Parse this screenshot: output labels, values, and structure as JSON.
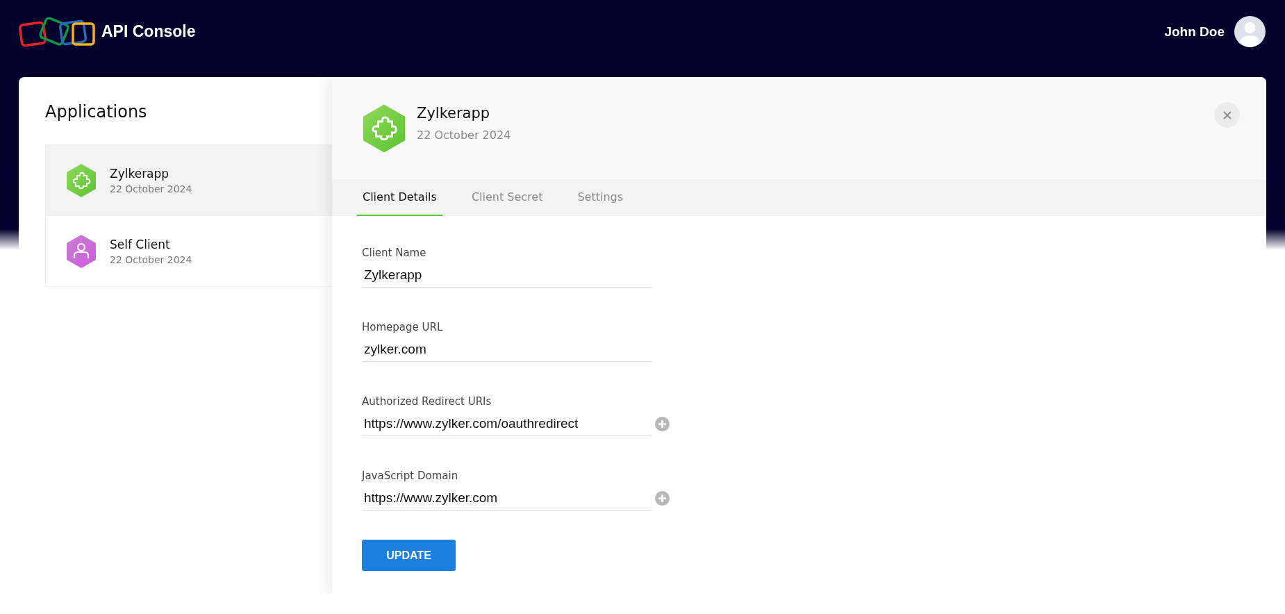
{
  "header": {
    "title": "API Console",
    "user_name": "John Doe"
  },
  "sidebar": {
    "title": "Applications",
    "items": [
      {
        "kind": "server",
        "name": "Zylkerapp",
        "date": "22 October 2024",
        "selected": true
      },
      {
        "kind": "self",
        "name": "Self Client",
        "date": "22 October 2024",
        "selected": false
      }
    ]
  },
  "detail": {
    "kind": "server",
    "name": "Zylkerapp",
    "date": "22 October 2024",
    "tabs": [
      {
        "label": "Client Details",
        "selected": true
      },
      {
        "label": "Client Secret",
        "selected": false
      },
      {
        "label": "Settings",
        "selected": false
      }
    ],
    "fields": [
      {
        "label": "Client Name",
        "value": "Zylkerapp",
        "addable": false
      },
      {
        "label": "Homepage URL",
        "value": "zylker.com",
        "addable": false
      },
      {
        "label": "Authorized Redirect URIs",
        "value": "https://www.zylker.com/oauthredirect",
        "addable": true
      },
      {
        "label": "JavaScript Domain",
        "value": "https://www.zylker.com",
        "addable": true
      }
    ],
    "button": "UPDATE"
  }
}
